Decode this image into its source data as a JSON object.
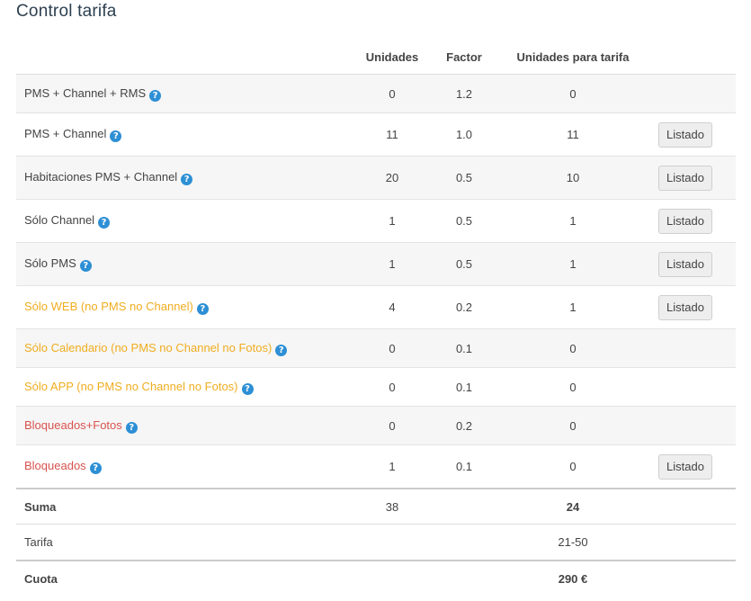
{
  "page": {
    "title": "Control tarifa"
  },
  "headers": {
    "col_name": "",
    "units": "Unidades",
    "factor": "Factor",
    "units_rate": "Unidades para tarifa",
    "actions": ""
  },
  "rows": [
    {
      "name": "PMS + Channel + RMS",
      "units": "0",
      "factor": "1.2",
      "units_rate": "0",
      "button": ""
    },
    {
      "name": "PMS + Channel",
      "units": "11",
      "factor": "1.0",
      "units_rate": "11",
      "button": "Listado"
    },
    {
      "name": "Habitaciones PMS + Channel",
      "units": "20",
      "factor": "0.5",
      "units_rate": "10",
      "button": "Listado"
    },
    {
      "name": "Sólo Channel",
      "units": "1",
      "factor": "0.5",
      "units_rate": "1",
      "button": "Listado"
    },
    {
      "name": "Sólo PMS",
      "units": "1",
      "factor": "0.5",
      "units_rate": "1",
      "button": "Listado"
    },
    {
      "name": "Sólo WEB (no PMS no Channel)",
      "units": "4",
      "factor": "0.2",
      "units_rate": "1",
      "button": "Listado"
    },
    {
      "name": "Sólo Calendario (no PMS no Channel no Fotos)",
      "units": "0",
      "factor": "0.1",
      "units_rate": "0",
      "button": ""
    },
    {
      "name": "Sólo APP (no PMS no Channel no Fotos)",
      "units": "0",
      "factor": "0.1",
      "units_rate": "0",
      "button": ""
    },
    {
      "name": "Bloqueados+Fotos",
      "units": "0",
      "factor": "0.2",
      "units_rate": "0",
      "button": ""
    },
    {
      "name": "Bloqueados",
      "units": "1",
      "factor": "0.1",
      "units_rate": "0",
      "button": "Listado"
    }
  ],
  "colors": {
    "orange": "#f0ad1f",
    "red": "#d9534f",
    "help_icon": "#2d8fd5"
  },
  "help_icon_glyph": "?",
  "summary": {
    "sum_label": "Suma",
    "sum_units": "38",
    "sum_rate": "24",
    "tarifa_label": "Tarifa",
    "tarifa_value": "21-50",
    "cuota_label": "Cuota",
    "cuota_value": "290 €"
  }
}
